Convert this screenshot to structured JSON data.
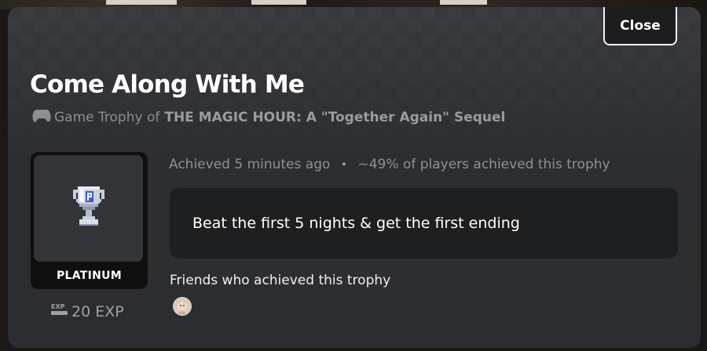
{
  "dialog": {
    "close_label": "Close",
    "title": "Come Along With Me",
    "subtitle_prefix": "Game Trophy of",
    "game_name": "THE MAGIC HOUR: A \"Together Again\" Sequel",
    "achieved": "Achieved 5 minutes ago",
    "separator": "•",
    "rarity": "~49% of players achieved this trophy",
    "description": "Beat the first 5 nights & get the first ending",
    "friends_label": "Friends who achieved this trophy"
  },
  "trophy": {
    "rank": "PLATINUM",
    "exp": "20 EXP",
    "icon": "trophy-cup-icon"
  },
  "icons": {
    "subtitle": "gamepad-icon",
    "exp": "exp-badge-icon"
  },
  "colors": {
    "panel": "#2a2c2f",
    "description_bg": "#1e1f21",
    "muted_text": "#8f9195",
    "trophy_silver": "#c9d0e0",
    "trophy_blue": "#3f5fb8"
  }
}
